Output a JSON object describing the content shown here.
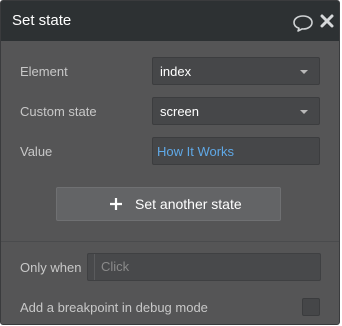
{
  "title": "Set state",
  "icons": {
    "comment": "comment-icon",
    "close": "close-icon",
    "plus": "plus-icon"
  },
  "fields": {
    "element": {
      "label": "Element",
      "value": "index"
    },
    "custom_state": {
      "label": "Custom state",
      "value": "screen"
    },
    "value": {
      "label": "Value",
      "value": "How It Works"
    }
  },
  "add_button": {
    "label": "Set another state"
  },
  "only_when": {
    "label": "Only when",
    "placeholder": "Click"
  },
  "breakpoint": {
    "label": "Add a breakpoint in debug mode",
    "checked": false
  },
  "colors": {
    "panel": "#555556",
    "titlebar": "#2d3133",
    "link_value": "#5fa8e6"
  }
}
